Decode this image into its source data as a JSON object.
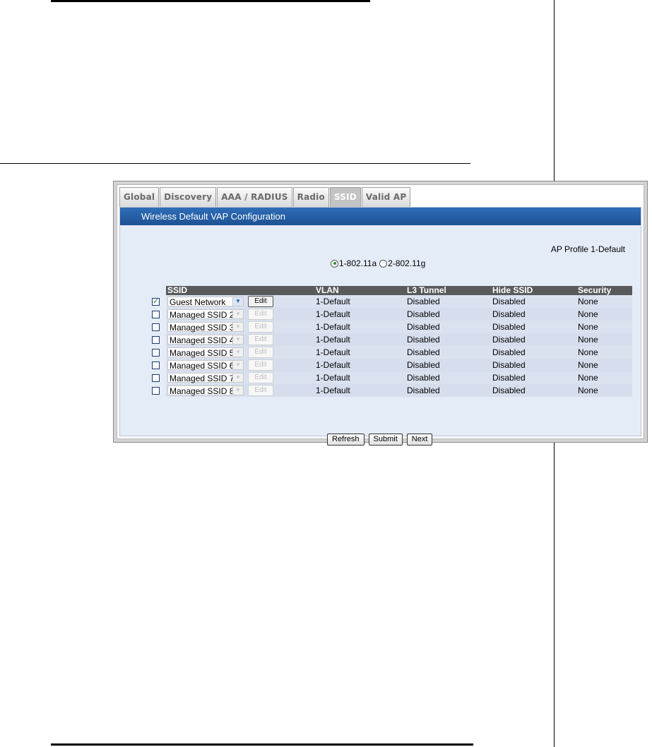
{
  "tabs": [
    {
      "label": "Global",
      "active": false
    },
    {
      "label": "Discovery",
      "active": false
    },
    {
      "label": "AAA / RADIUS",
      "active": false
    },
    {
      "label": "Radio",
      "active": false
    },
    {
      "label": "SSID",
      "active": true
    },
    {
      "label": "Valid AP",
      "active": false
    }
  ],
  "header": {
    "title": "Wireless Default VAP Configuration"
  },
  "ap_profile": "AP Profile 1-Default",
  "radios": {
    "option1": "1-802.11a",
    "option2": "2-802.11g",
    "selected": "1-802.11a"
  },
  "table": {
    "columns": [
      "SSID",
      "VLAN",
      "L3 Tunnel",
      "Hide SSID",
      "Security"
    ],
    "edit_label": "Edit",
    "rows": [
      {
        "checked": true,
        "ssid": "Guest Network",
        "vlan": "1-Default",
        "l3": "Disabled",
        "hide": "Disabled",
        "security": "None"
      },
      {
        "checked": false,
        "ssid": "Managed SSID 2",
        "vlan": "1-Default",
        "l3": "Disabled",
        "hide": "Disabled",
        "security": "None"
      },
      {
        "checked": false,
        "ssid": "Managed SSID 3",
        "vlan": "1-Default",
        "l3": "Disabled",
        "hide": "Disabled",
        "security": "None"
      },
      {
        "checked": false,
        "ssid": "Managed SSID 4",
        "vlan": "1-Default",
        "l3": "Disabled",
        "hide": "Disabled",
        "security": "None"
      },
      {
        "checked": false,
        "ssid": "Managed SSID 5",
        "vlan": "1-Default",
        "l3": "Disabled",
        "hide": "Disabled",
        "security": "None"
      },
      {
        "checked": false,
        "ssid": "Managed SSID 6",
        "vlan": "1-Default",
        "l3": "Disabled",
        "hide": "Disabled",
        "security": "None"
      },
      {
        "checked": false,
        "ssid": "Managed SSID 7",
        "vlan": "1-Default",
        "l3": "Disabled",
        "hide": "Disabled",
        "security": "None"
      },
      {
        "checked": false,
        "ssid": "Managed SSID 8",
        "vlan": "1-Default",
        "l3": "Disabled",
        "hide": "Disabled",
        "security": "None"
      }
    ]
  },
  "buttons": {
    "refresh": "Refresh",
    "submit": "Submit",
    "next": "Next"
  },
  "colors": {
    "header_blue": "#1e5193",
    "content_bg": "#e4ecf7",
    "table_header": "#5a5a5a"
  }
}
